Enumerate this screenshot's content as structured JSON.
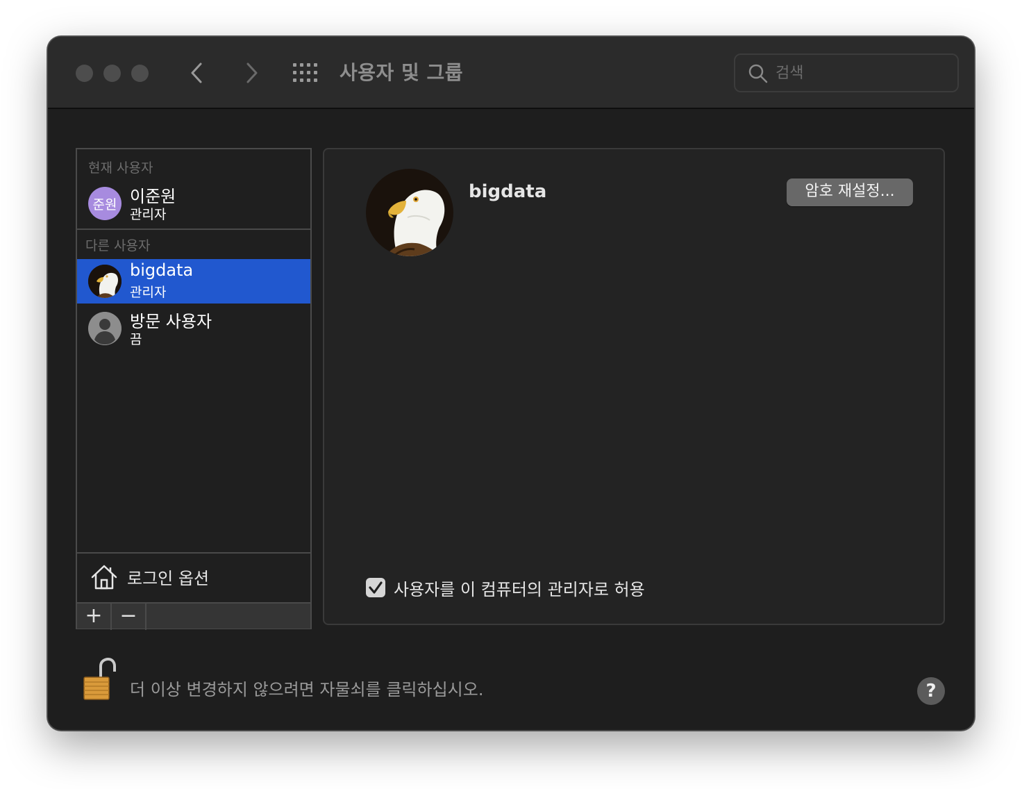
{
  "window": {
    "title": "사용자 및 그룹",
    "search_placeholder": "검색"
  },
  "sidebar": {
    "current_section_label": "현재 사용자",
    "current_user": {
      "initials": "준원",
      "name": "이준원",
      "role": "관리자"
    },
    "other_section_label": "다른 사용자",
    "other_users": [
      {
        "name": "bigdata",
        "role": "관리자",
        "avatar": "eagle-avatar",
        "selected": true
      },
      {
        "name": "방문 사용자",
        "role": "끔",
        "avatar": "generic-person-icon",
        "selected": false
      }
    ],
    "login_options_label": "로그인 옵션",
    "add_label": "+",
    "remove_label": "−"
  },
  "detail": {
    "username": "bigdata",
    "reset_password_label": "암호 재설정...",
    "allow_admin_label": "사용자를 이 컴퓨터의 관리자로 허용",
    "allow_admin_checked": true
  },
  "footer": {
    "lock_text": "더 이상 변경하지 않으려면 자물쇠를 클릭하십시오.",
    "help_label": "?"
  },
  "colors": {
    "selection": "#2158cf",
    "window_bg": "#1e1e1e",
    "titlebar_bg": "#2b2b2b",
    "avatar_purple": "#a78bdf"
  }
}
